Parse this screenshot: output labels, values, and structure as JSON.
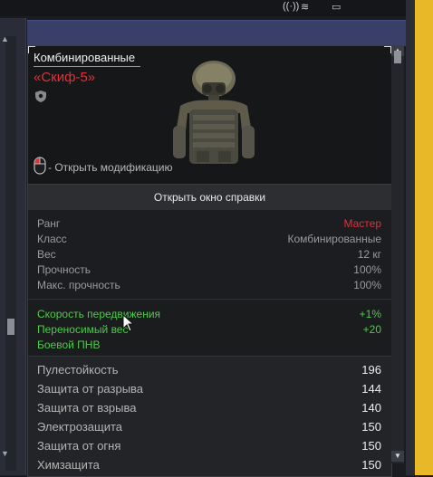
{
  "item": {
    "category": "Комбинированные",
    "name": "«Скиф-5»",
    "mod_hint": "- Открыть модификацию"
  },
  "help_button": "Открыть окно справки",
  "info": [
    {
      "label": "Ранг",
      "value": "Мастер",
      "value_color": "#e0303a"
    },
    {
      "label": "Класс",
      "value": "Комбинированные"
    },
    {
      "label": "Вес",
      "value": "12 кг"
    },
    {
      "label": "Прочность",
      "value": "100%"
    },
    {
      "label": "Макс. прочность",
      "value": "100%"
    }
  ],
  "bonuses": [
    {
      "label": "Скорость передвижения",
      "value": "+1%"
    },
    {
      "label": "Переносимый вес",
      "value": "+20"
    },
    {
      "label": "Боевой ПНВ",
      "value": ""
    }
  ],
  "protection": [
    {
      "label": "Пулестойкость",
      "value": "196"
    },
    {
      "label": "Защита от разрыва",
      "value": "144"
    },
    {
      "label": "Защита от взрыва",
      "value": "140"
    },
    {
      "label": "Электрозащита",
      "value": "150"
    },
    {
      "label": "Защита от огня",
      "value": "150"
    },
    {
      "label": "Химзащита",
      "value": "150"
    }
  ],
  "colors": {
    "rank_red": "#e0303a",
    "bonus_green": "#4fc84f",
    "header_blue": "#3a3f6a",
    "accent_yellow": "#e8b829"
  }
}
